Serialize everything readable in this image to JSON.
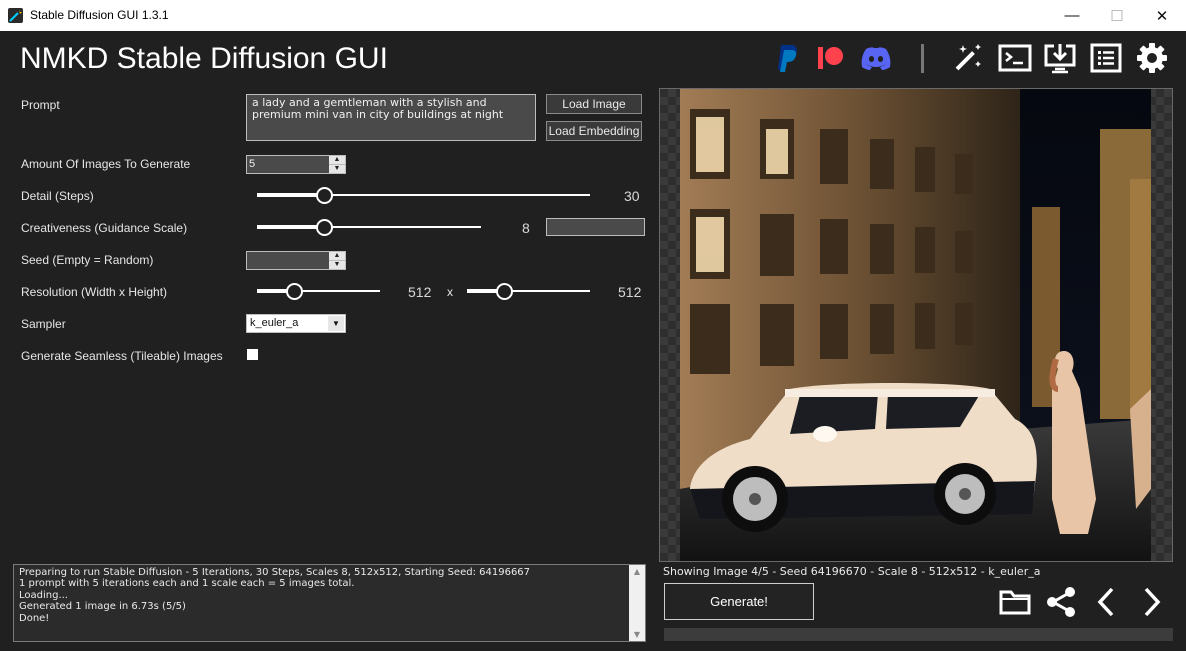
{
  "window": {
    "title": "Stable Diffusion GUI 1.3.1",
    "minimize": "—",
    "maximize": "☐",
    "close": "✕"
  },
  "header": {
    "app_title": "NMKD Stable Diffusion GUI",
    "icons": [
      "paypal-icon",
      "patreon-icon",
      "discord-icon",
      "magic-wand-icon",
      "terminal-icon",
      "download-icon",
      "list-icon",
      "settings-icon"
    ]
  },
  "prompt": {
    "label": "Prompt",
    "value": "a lady and a gemtleman with a stylish and premium mini van in city of buildings at night",
    "load_image": "Load Image",
    "load_embedding": "Load Embedding"
  },
  "amount": {
    "label": "Amount Of Images To Generate",
    "value": "5"
  },
  "steps": {
    "label": "Detail (Steps)",
    "value": "30",
    "fraction": 0.2
  },
  "guidance": {
    "label": "Creativeness (Guidance Scale)",
    "value": "8",
    "fraction": 0.3,
    "field_value": ""
  },
  "seed": {
    "label": "Seed (Empty = Random)",
    "value": ""
  },
  "resolution": {
    "label": "Resolution (Width x Height)",
    "width": "512",
    "height": "512",
    "separator": "x",
    "width_fraction": 0.3,
    "height_fraction": 0.3
  },
  "sampler": {
    "label": "Sampler",
    "value": "k_euler_a"
  },
  "seamless": {
    "label": "Generate Seamless (Tileable) Images",
    "checked": false
  },
  "log": {
    "lines": [
      "Preparing to run Stable Diffusion - 5 Iterations, 30 Steps, Scales 8, 512x512, Starting Seed: 64196667",
      "1 prompt with 5 iterations each and 1 scale each = 5 images total.",
      "Loading...",
      "Generated 1 image in 6.73s (5/5)",
      "Done!"
    ]
  },
  "preview": {
    "info": "Showing Image 4/5  - Seed 64196670 - Scale 8 - 512x512 - k_euler_a",
    "generate_label": "Generate!"
  },
  "colors": {
    "background": "#202020",
    "paypal": "#0079c1",
    "patreon": "#ff424d",
    "discord": "#5865f2"
  }
}
